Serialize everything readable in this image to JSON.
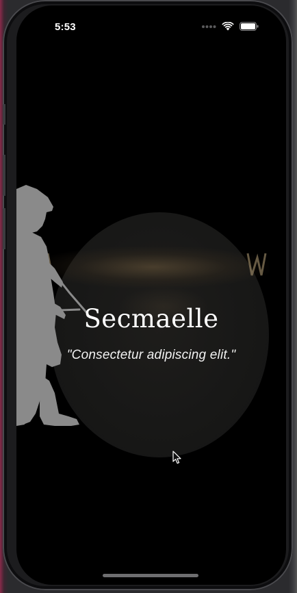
{
  "status_bar": {
    "time": "5:53",
    "icons": [
      "cellular-dots-icon",
      "wifi-icon",
      "battery-icon"
    ]
  },
  "hero": {
    "title": "Secmaelle",
    "quote": "\"Consectetur adipiscing elit.\""
  },
  "decor": {
    "silhouette": "archer-silhouette",
    "silhouette_color": "#8a8a8a",
    "disc_color": "#1a1a19",
    "banner_glow_color": "#6e5a3c"
  },
  "colors": {
    "screen_background": "#000000",
    "text_primary": "#ffffff",
    "home_indicator": "#6e6e70"
  }
}
